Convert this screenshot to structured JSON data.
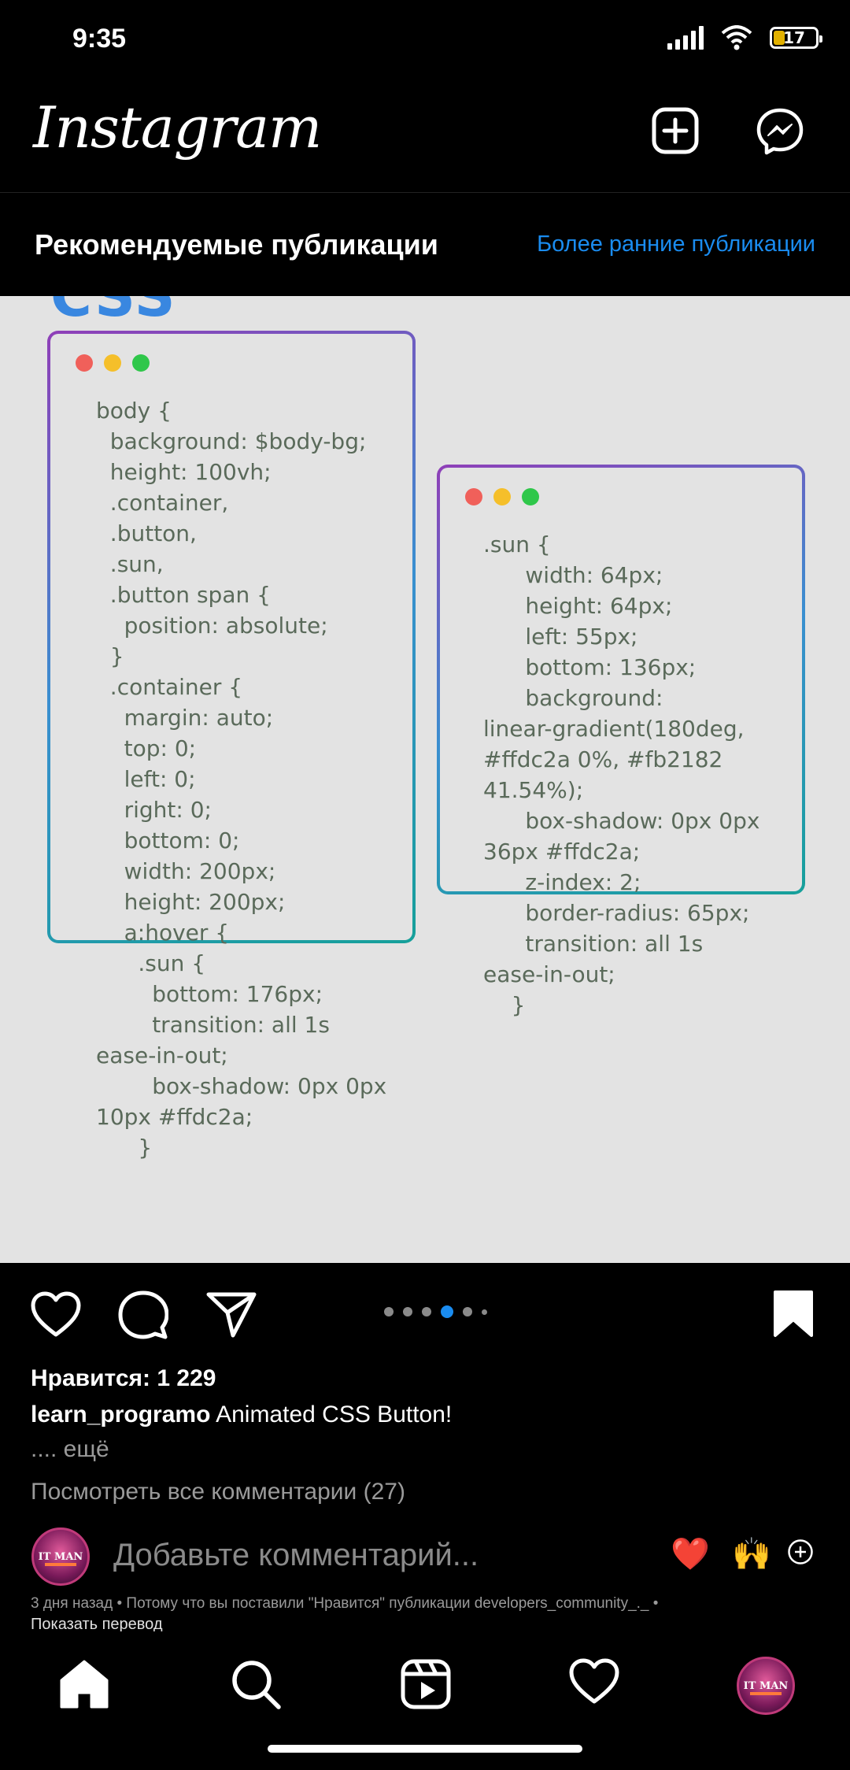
{
  "status_bar": {
    "time": "9:35",
    "battery": "17"
  },
  "header": {
    "logo": "Instagram"
  },
  "feed": {
    "title": "Рекомендуемые публикации",
    "older_link": "Более ранние публикации"
  },
  "post": {
    "image": {
      "heading": "CSS",
      "left_code": "body {\n  background: $body-bg;\n  height: 100vh;\n  .container,\n  .button,\n  .sun,\n  .button span {\n    position: absolute;\n  }\n  .container {\n    margin: auto;\n    top: 0;\n    left: 0;\n    right: 0;\n    bottom: 0;\n    width: 200px;\n    height: 200px;\n    a:hover {\n      .sun {\n        bottom: 176px;\n        transition: all 1s\nease-in-out;\n        box-shadow: 0px 0px\n10px #ffdc2a;\n      }",
      "right_code": ".sun {\n      width: 64px;\n      height: 64px;\n      left: 55px;\n      bottom: 136px;\n      background:\nlinear-gradient(180deg,\n#ffdc2a 0%, #fb2182\n41.54%);\n      box-shadow: 0px 0px\n36px #ffdc2a;\n      z-index: 2;\n      border-radius: 65px;\n      transition: all 1s\nease-in-out;\n    }"
    },
    "carousel": {
      "count": 6,
      "active_index": 3
    },
    "likes": "Нравится: 1 229",
    "caption_user": "learn_programo",
    "caption_text": " Animated CSS Button!",
    "caption_more": ".... ещё",
    "view_comments": "Посмотреть все комментарии (27)",
    "comment_placeholder": "Добавьте комментарий...",
    "avatar_text": "IT MAN",
    "reactions": {
      "heart": "❤️",
      "hands": "🙌"
    },
    "meta": "3 дня назад • Потому что вы поставили \"Нравится\" публикации developers_community_._ •",
    "show_translation": "Показать перевод"
  },
  "nav": {
    "items": [
      "home",
      "search",
      "reels",
      "activity",
      "profile"
    ],
    "profile_avatar_text": "IT MAN"
  },
  "colors": {
    "accent_blue": "#1a8cf0",
    "code_text": "#5a6a5a",
    "css_heading": "#3987e0",
    "dot_red": "#f0605a",
    "dot_yellow": "#f5bf2a",
    "dot_green": "#2fc74a"
  }
}
